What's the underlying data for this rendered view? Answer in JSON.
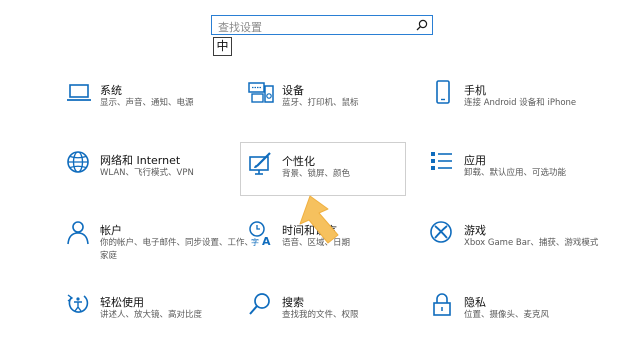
{
  "search": {
    "placeholder": "查找设置"
  },
  "ime": {
    "label": "中"
  },
  "colors": {
    "accent": "#0f6cbd",
    "search_border": "#2a7fd4",
    "arrow": "#f6c15e"
  },
  "tiles": [
    {
      "title": "系统",
      "desc": "显示、声音、通知、电源",
      "icon": "laptop-icon"
    },
    {
      "title": "设备",
      "desc": "蓝牙、打印机、鼠标",
      "icon": "keyboard-speaker-icon"
    },
    {
      "title": "手机",
      "desc": "连接 Android 设备和 iPhone",
      "icon": "phone-icon"
    },
    {
      "title": "网络和 Internet",
      "desc": "WLAN、飞行模式、VPN",
      "icon": "globe-icon"
    },
    {
      "title": "个性化",
      "desc": "背景、锁屏、颜色",
      "icon": "monitor-brush-icon"
    },
    {
      "title": "应用",
      "desc": "卸载、默认应用、可选功能",
      "icon": "apps-list-icon"
    },
    {
      "title": "帐户",
      "desc": "你的帐户、电子邮件、同步设置、工作、家庭",
      "icon": "person-icon"
    },
    {
      "title": "时间和语言",
      "desc": "语音、区域、日期",
      "icon": "time-language-icon"
    },
    {
      "title": "游戏",
      "desc": "Xbox Game Bar、捕获、游戏模式",
      "icon": "xbox-icon"
    },
    {
      "title": "轻松使用",
      "desc": "讲述人、放大镜、高对比度",
      "icon": "ease-of-access-icon"
    },
    {
      "title": "搜索",
      "desc": "查找我的文件、权限",
      "icon": "search-magnifier-icon"
    },
    {
      "title": "隐私",
      "desc": "位置、摄像头、麦克风",
      "icon": "lock-icon"
    }
  ]
}
